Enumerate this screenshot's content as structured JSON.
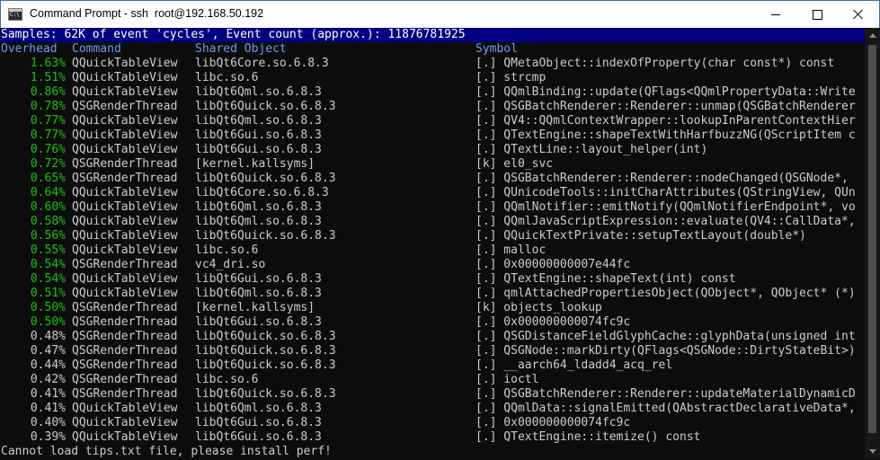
{
  "window": {
    "title": "Command Prompt - ssh  root@192.168.50.192",
    "controls": {
      "minimize": "minimize",
      "maximize": "maximize",
      "close": "close"
    }
  },
  "terminal": {
    "summary": "Samples: 62K of event 'cycles', Event count (approx.): 11876781925",
    "headers": {
      "overhead": "Overhead",
      "command": "Command",
      "shared_object": "Shared Object",
      "symbol": "Symbol"
    },
    "rows": [
      {
        "overhead": "1.63%",
        "command": "QQuickTableView",
        "shared_object": "libQt6Core.so.6.8.3",
        "symbol": "[.] QMetaObject::indexOfProperty(char const*) const",
        "hot": true
      },
      {
        "overhead": "1.51%",
        "command": "QQuickTableView",
        "shared_object": "libc.so.6",
        "symbol": "[.] strcmp",
        "hot": true
      },
      {
        "overhead": "0.86%",
        "command": "QQuickTableView",
        "shared_object": "libQt6Qml.so.6.8.3",
        "symbol": "[.] QQmlBinding::update(QFlags<QQmlPropertyData::Write",
        "hot": true
      },
      {
        "overhead": "0.78%",
        "command": "QSGRenderThread",
        "shared_object": "libQt6Quick.so.6.8.3",
        "symbol": "[.] QSGBatchRenderer::Renderer::unmap(QSGBatchRenderer",
        "hot": true
      },
      {
        "overhead": "0.77%",
        "command": "QQuickTableView",
        "shared_object": "libQt6Qml.so.6.8.3",
        "symbol": "[.] QV4::QQmlContextWrapper::lookupInParentContextHier",
        "hot": true
      },
      {
        "overhead": "0.77%",
        "command": "QQuickTableView",
        "shared_object": "libQt6Gui.so.6.8.3",
        "symbol": "[.] QTextEngine::shapeTextWithHarfbuzzNG(QScriptItem c",
        "hot": true
      },
      {
        "overhead": "0.76%",
        "command": "QQuickTableView",
        "shared_object": "libQt6Gui.so.6.8.3",
        "symbol": "[.] QTextLine::layout_helper(int)",
        "hot": true
      },
      {
        "overhead": "0.72%",
        "command": "QSGRenderThread",
        "shared_object": "[kernel.kallsyms]",
        "symbol": "[k] el0_svc",
        "hot": true
      },
      {
        "overhead": "0.65%",
        "command": "QSGRenderThread",
        "shared_object": "libQt6Quick.so.6.8.3",
        "symbol": "[.] QSGBatchRenderer::Renderer::nodeChanged(QSGNode*,",
        "hot": true
      },
      {
        "overhead": "0.64%",
        "command": "QQuickTableView",
        "shared_object": "libQt6Core.so.6.8.3",
        "symbol": "[.] QUnicodeTools::initCharAttributes(QStringView, QUn",
        "hot": true
      },
      {
        "overhead": "0.60%",
        "command": "QQuickTableView",
        "shared_object": "libQt6Qml.so.6.8.3",
        "symbol": "[.] QQmlNotifier::emitNotify(QQmlNotifierEndpoint*, vo",
        "hot": true
      },
      {
        "overhead": "0.58%",
        "command": "QQuickTableView",
        "shared_object": "libQt6Qml.so.6.8.3",
        "symbol": "[.] QQmlJavaScriptExpression::evaluate(QV4::CallData*,",
        "hot": true
      },
      {
        "overhead": "0.56%",
        "command": "QQuickTableView",
        "shared_object": "libQt6Quick.so.6.8.3",
        "symbol": "[.] QQuickTextPrivate::setupTextLayout(double*)",
        "hot": true
      },
      {
        "overhead": "0.55%",
        "command": "QQuickTableView",
        "shared_object": "libc.so.6",
        "symbol": "[.] malloc",
        "hot": true
      },
      {
        "overhead": "0.54%",
        "command": "QSGRenderThread",
        "shared_object": "vc4_dri.so",
        "symbol": "[.] 0x00000000007e44fc",
        "hot": true
      },
      {
        "overhead": "0.54%",
        "command": "QQuickTableView",
        "shared_object": "libQt6Gui.so.6.8.3",
        "symbol": "[.] QTextEngine::shapeText(int) const",
        "hot": true
      },
      {
        "overhead": "0.51%",
        "command": "QQuickTableView",
        "shared_object": "libQt6Qml.so.6.8.3",
        "symbol": "[.] qmlAttachedPropertiesObject(QObject*, QObject* (*)",
        "hot": true
      },
      {
        "overhead": "0.50%",
        "command": "QSGRenderThread",
        "shared_object": "[kernel.kallsyms]",
        "symbol": "[k] objects_lookup",
        "hot": true
      },
      {
        "overhead": "0.50%",
        "command": "QSGRenderThread",
        "shared_object": "libQt6Gui.so.6.8.3",
        "symbol": "[.] 0x000000000074fc9c",
        "hot": true
      },
      {
        "overhead": "0.48%",
        "command": "QSGRenderThread",
        "shared_object": "libQt6Quick.so.6.8.3",
        "symbol": "[.] QSGDistanceFieldGlyphCache::glyphData(unsigned int",
        "hot": false
      },
      {
        "overhead": "0.47%",
        "command": "QSGRenderThread",
        "shared_object": "libQt6Quick.so.6.8.3",
        "symbol": "[.] QSGNode::markDirty(QFlags<QSGNode::DirtyStateBit>)",
        "hot": false
      },
      {
        "overhead": "0.44%",
        "command": "QSGRenderThread",
        "shared_object": "libQt6Quick.so.6.8.3",
        "symbol": "[.] __aarch64_ldadd4_acq_rel",
        "hot": false
      },
      {
        "overhead": "0.42%",
        "command": "QSGRenderThread",
        "shared_object": "libc.so.6",
        "symbol": "[.] ioctl",
        "hot": false
      },
      {
        "overhead": "0.41%",
        "command": "QSGRenderThread",
        "shared_object": "libQt6Quick.so.6.8.3",
        "symbol": "[.] QSGBatchRenderer::Renderer::updateMaterialDynamicD",
        "hot": false
      },
      {
        "overhead": "0.41%",
        "command": "QQuickTableView",
        "shared_object": "libQt6Qml.so.6.8.3",
        "symbol": "[.] QQmlData::signalEmitted(QAbstractDeclarativeData*,",
        "hot": false
      },
      {
        "overhead": "0.40%",
        "command": "QQuickTableView",
        "shared_object": "libQt6Gui.so.6.8.3",
        "symbol": "[.] 0x000000000074fc9c",
        "hot": false
      },
      {
        "overhead": "0.39%",
        "command": "QQuickTableView",
        "shared_object": "libQt6Gui.so.6.8.3",
        "symbol": "[.] QTextEngine::itemize() const",
        "hot": false
      }
    ],
    "footer": "Cannot load tips.txt file, please install perf!"
  },
  "colors": {
    "summary_bg": "#000080",
    "header_text": "#6a9ee8",
    "hot_overhead": "#16c60c",
    "normal_text": "#cccccc",
    "console_bg": "#0c0c0c"
  },
  "icons": [
    "console-app-icon",
    "minimize-icon",
    "maximize-icon",
    "close-icon",
    "scroll-up-arrow-icon",
    "scroll-down-arrow-icon"
  ]
}
